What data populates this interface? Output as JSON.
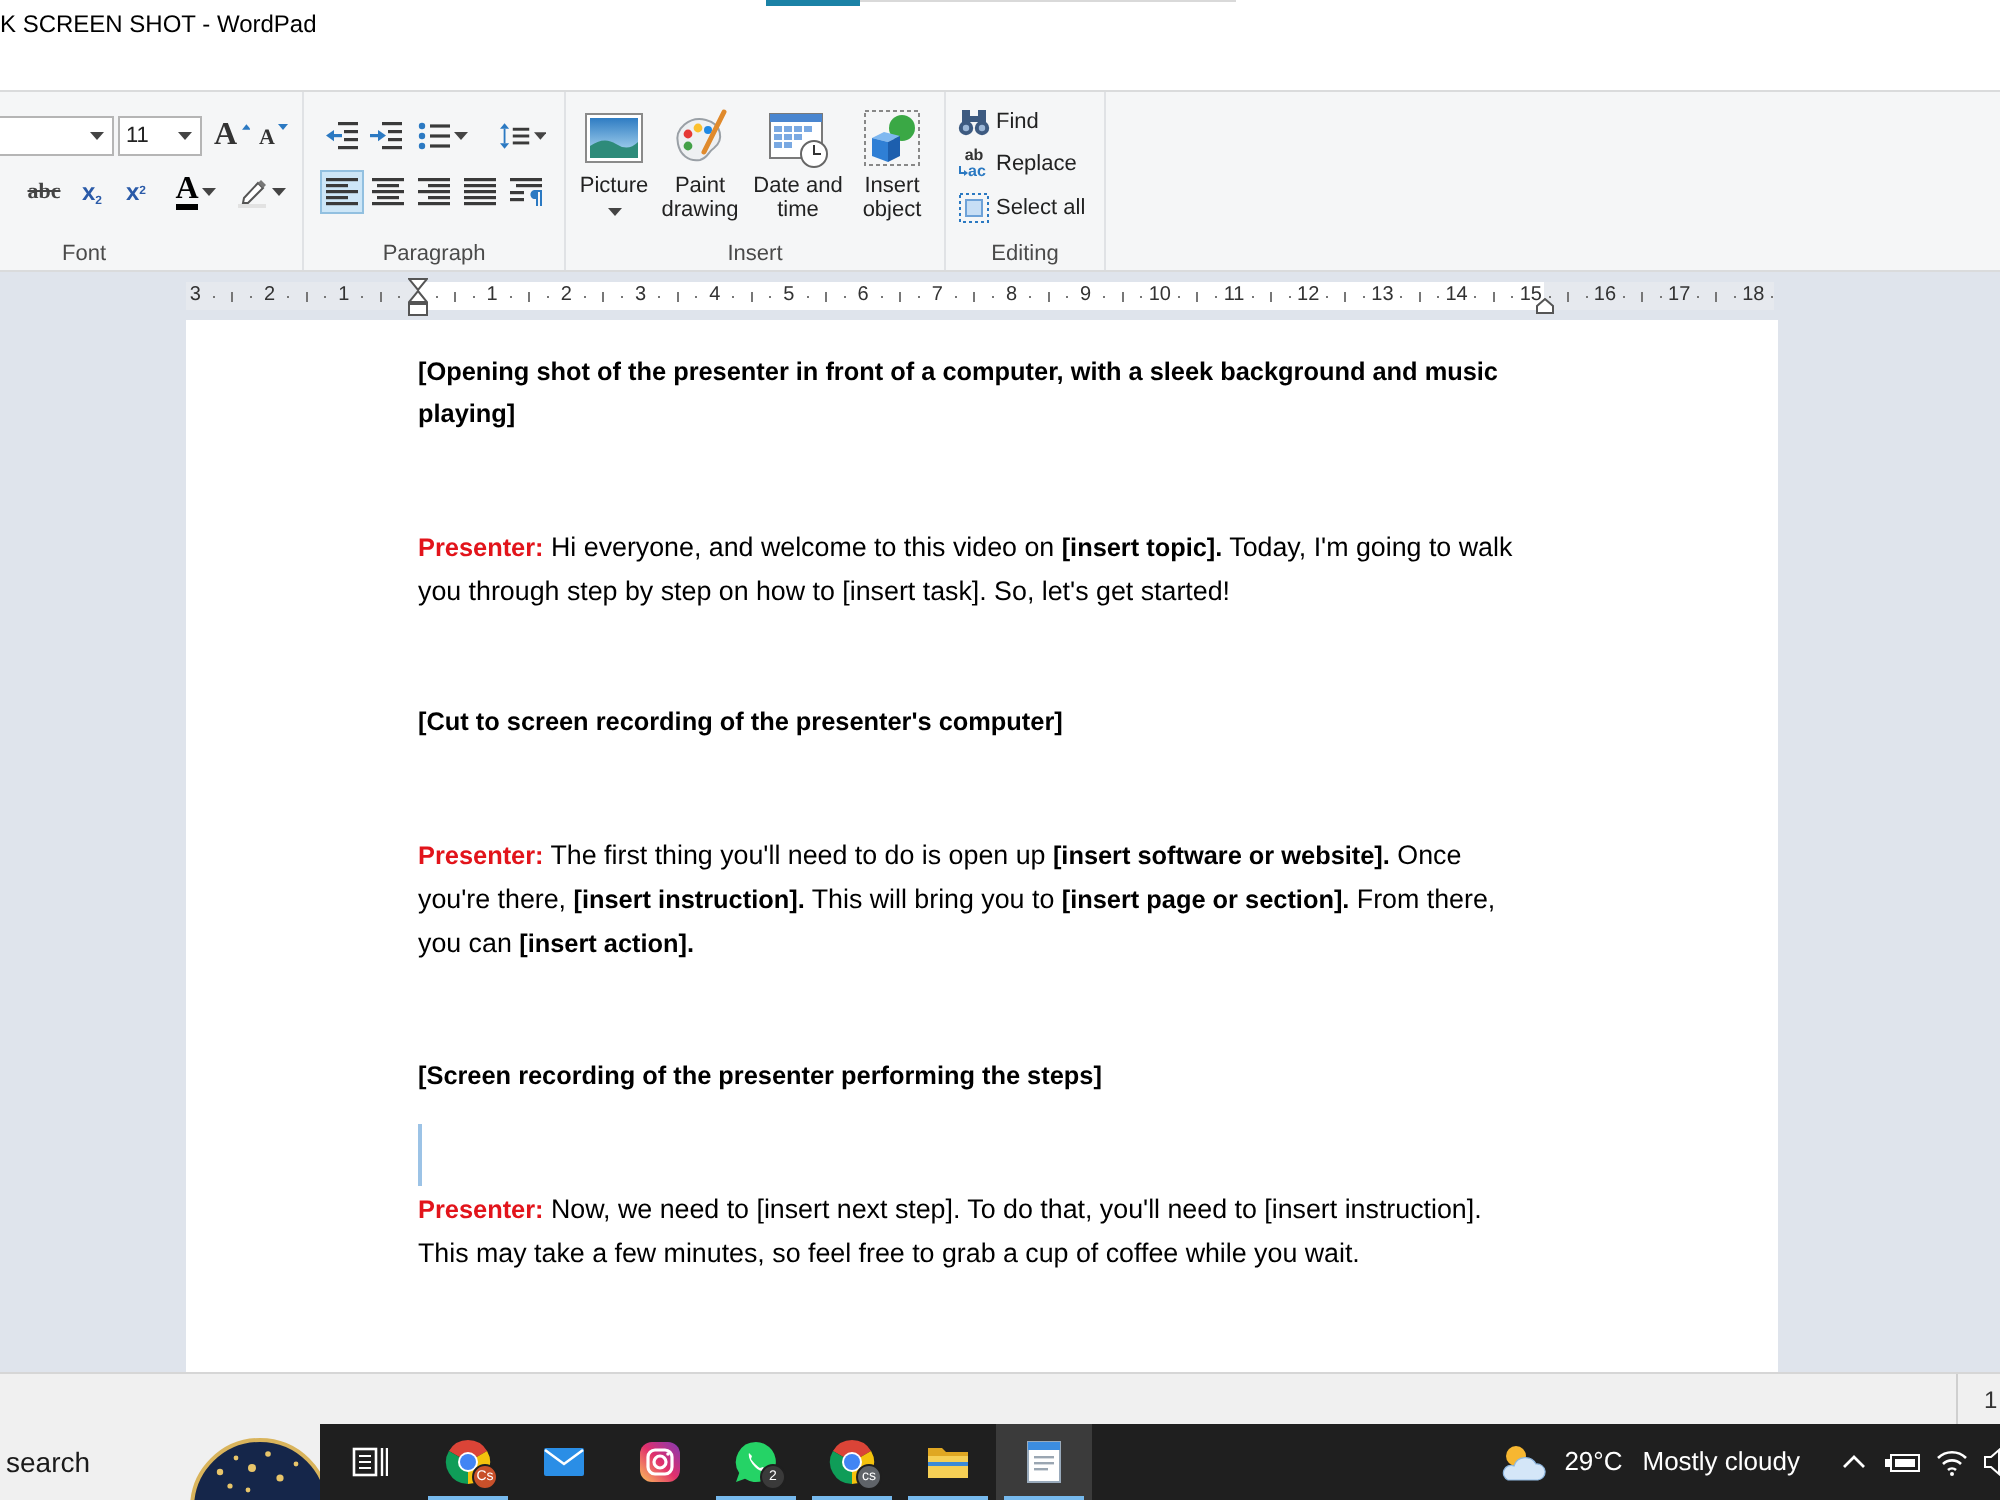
{
  "window": {
    "title": "K SCREEN SHOT - WordPad"
  },
  "ribbon": {
    "font": {
      "label": "Font",
      "font_size": "11",
      "tools": [
        {
          "kind": "grow",
          "glyph": "A"
        },
        {
          "kind": "shrink",
          "glyph": "A"
        },
        {
          "kind": "strikethrough",
          "glyph": "abc"
        },
        {
          "kind": "subscript",
          "glyph": "x$_{2}$"
        },
        {
          "kind": "superscript",
          "glyph": "x$^{2}$"
        },
        {
          "kind": "font-color",
          "glyph": "A"
        },
        {
          "kind": "highlight"
        }
      ]
    },
    "paragraph": {
      "label": "Paragraph",
      "alignment": [
        {
          "kind": "left",
          "selected": true
        },
        {
          "kind": "center",
          "selected": false
        },
        {
          "kind": "right",
          "selected": false
        },
        {
          "kind": "justify",
          "selected": false
        }
      ]
    },
    "insert": {
      "label": "Insert",
      "buttons": [
        {
          "kind": "picture",
          "label": "Picture",
          "dropdown": true
        },
        {
          "kind": "paint",
          "label": "Paint drawing",
          "dropdown": false
        },
        {
          "kind": "datetime",
          "label": "Date and time",
          "dropdown": false
        },
        {
          "kind": "object",
          "label": "Insert object",
          "dropdown": false
        }
      ]
    },
    "editing": {
      "label": "Editing",
      "commands": [
        {
          "kind": "find",
          "label": "Find"
        },
        {
          "kind": "replace",
          "label": "Replace",
          "glyph_top": "ab",
          "glyph_bottom": "ac"
        },
        {
          "kind": "select",
          "label": "Select all"
        }
      ]
    }
  },
  "ruler": {
    "left_labels": [
      "3",
      "2",
      "1"
    ],
    "right_labels": [
      "1",
      "2",
      "3",
      "4",
      "5",
      "6",
      "7",
      "8",
      "9",
      "10",
      "11",
      "12",
      "13",
      "14",
      "15",
      "16",
      "17",
      "18"
    ]
  },
  "document": {
    "paragraphs": [
      {
        "kind": "direction",
        "text": "[Opening shot of the presenter in front of a computer, with a sleek background and music playing]",
        "caret_below": false
      },
      {
        "kind": "dialogue",
        "speaker": "Presenter:",
        "text": "Hi everyone, and welcome to this video on **[insert topic].** Today, I'm going to walk you through step by step on how to [insert task]. So, let's get started!",
        "caret_below": false
      },
      {
        "kind": "direction",
        "text": "[Cut to screen recording of the presenter's computer]",
        "caret_below": false
      },
      {
        "kind": "dialogue",
        "speaker": "Presenter:",
        "text": "The first thing you'll need to do is open up **[insert software or website].** Once you're there, **[insert instruction].** This will bring you to **[insert page or section].** From there, you can **[insert action].**",
        "caret_below": false
      },
      {
        "kind": "direction",
        "text": "[Screen recording of the presenter performing the steps]",
        "caret_below": true
      },
      {
        "kind": "dialogue",
        "speaker": "Presenter:",
        "text": "Now, we need to [insert next step]. To do that, you'll need to [insert instruction]. This may take a few minutes, so feel free to grab a cup of coffee while you wait.",
        "caret_below": false
      }
    ]
  },
  "status_bar": {
    "text": "1"
  },
  "taskbar": {
    "search": {
      "placeholder": "search"
    },
    "apps": [
      {
        "kind": "browser",
        "badge": "Cs",
        "color": "#c8502a",
        "running": true,
        "selected": false
      },
      {
        "kind": "mail",
        "running": false,
        "selected": false
      },
      {
        "kind": "camera",
        "running": false,
        "selected": false
      },
      {
        "kind": "chat",
        "badge": "2",
        "color": "#3a3a3a",
        "running": true,
        "selected": false
      },
      {
        "kind": "browser",
        "badge": "cs",
        "color": "#5f6368",
        "running": true,
        "selected": false
      },
      {
        "kind": "folder",
        "running": true,
        "selected": false
      },
      {
        "kind": "document",
        "running": true,
        "selected": true
      }
    ],
    "weather": {
      "temperature": "29°C",
      "condition": "Mostly cloudy"
    }
  }
}
